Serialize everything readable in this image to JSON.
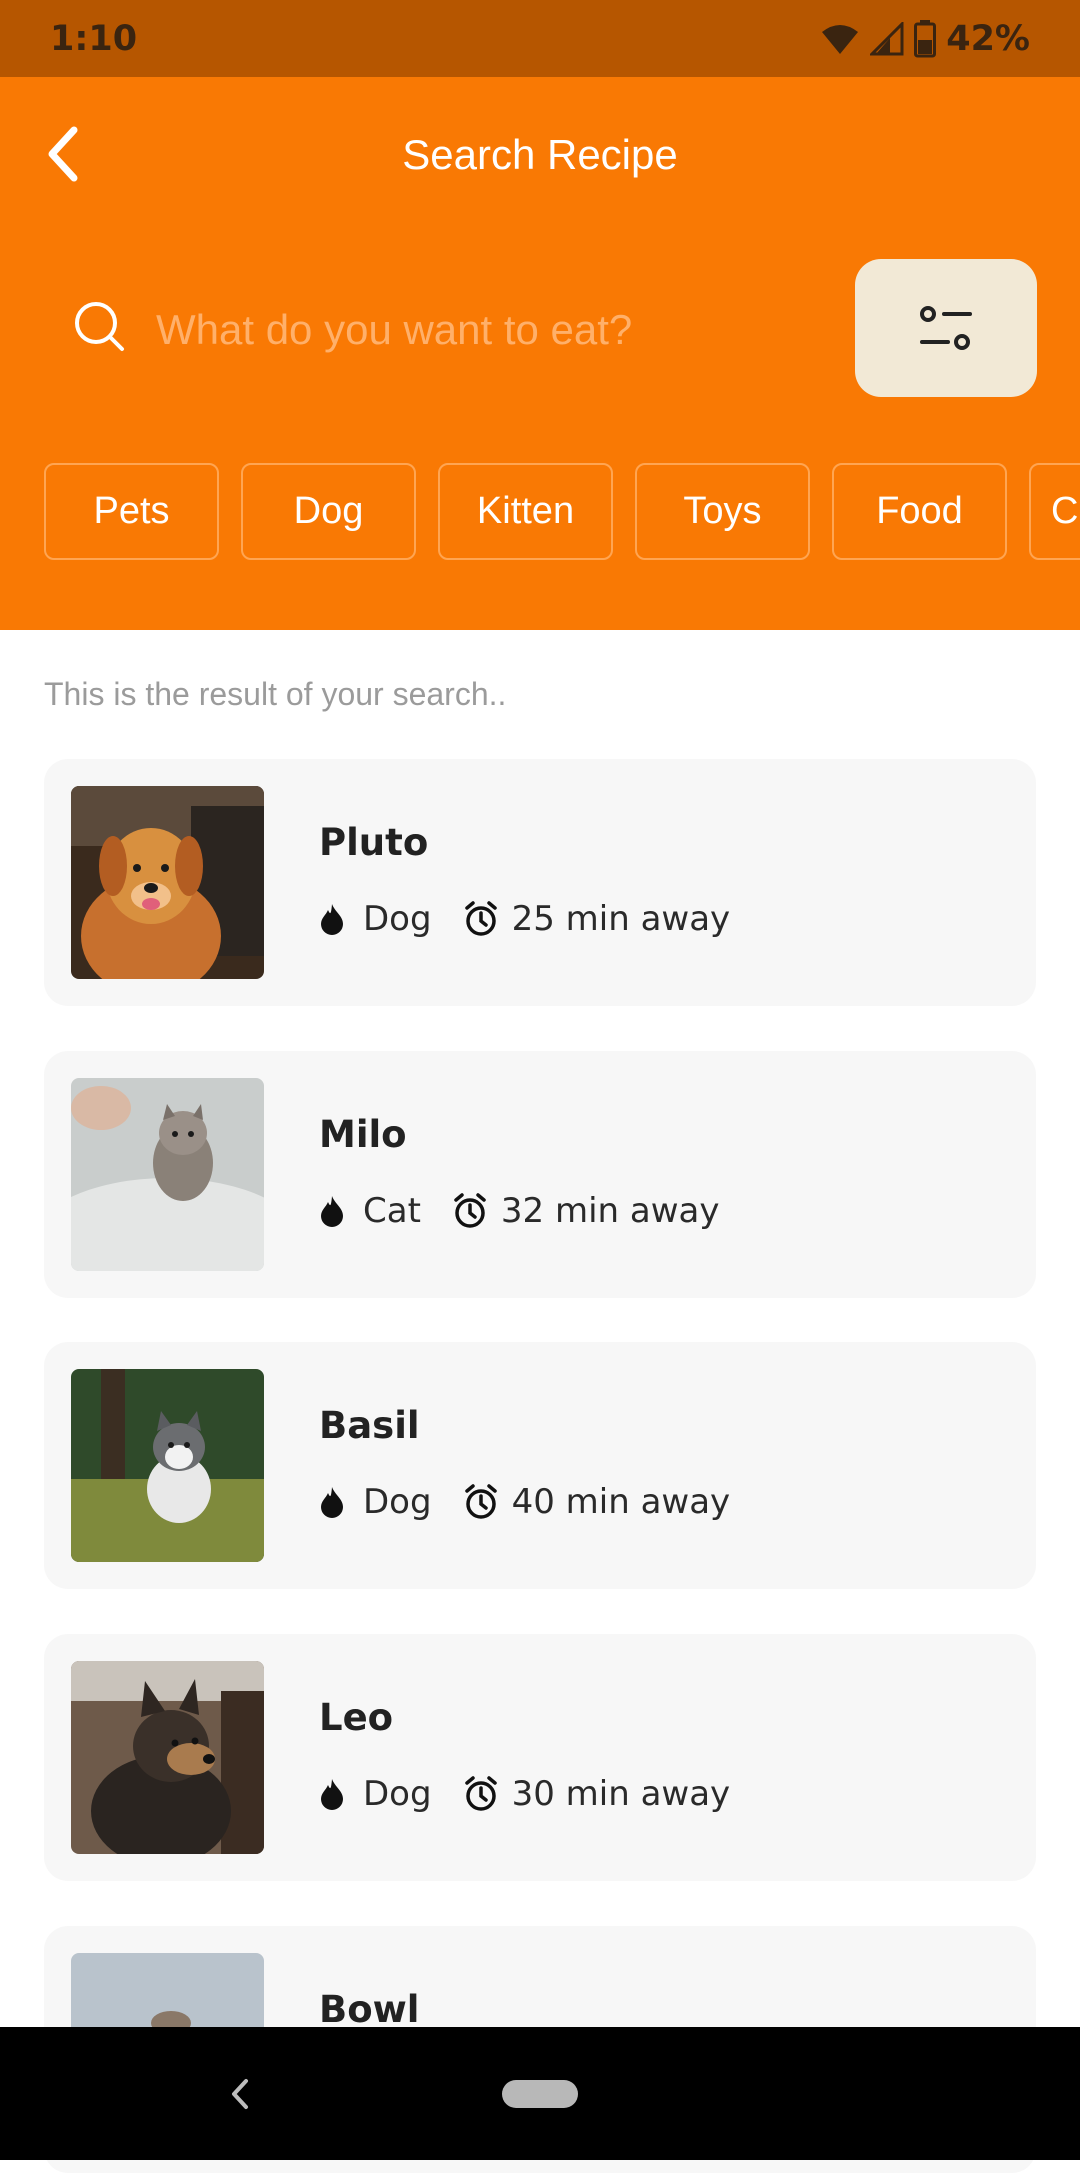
{
  "status_bar": {
    "time": "1:10",
    "battery": "42%"
  },
  "header": {
    "title": "Search Recipe",
    "search_placeholder": "What do you want to eat?",
    "chips": [
      "Pets",
      "Dog",
      "Kitten",
      "Toys",
      "Food",
      "C"
    ]
  },
  "results": {
    "caption": "This is the result of your search..",
    "items": [
      {
        "name": "Pluto",
        "type": "Dog",
        "distance": "25 min away"
      },
      {
        "name": "Milo",
        "type": "Cat",
        "distance": "32 min away"
      },
      {
        "name": "Basil",
        "type": "Dog",
        "distance": "40 min away"
      },
      {
        "name": "Leo",
        "type": "Dog",
        "distance": "30 min away"
      },
      {
        "name": "Bowl"
      }
    ]
  },
  "colors": {
    "accent": "#f97904",
    "status_bar": "#b65600",
    "filter_button": "#f2e9d6",
    "card": "#f7f7f7"
  }
}
